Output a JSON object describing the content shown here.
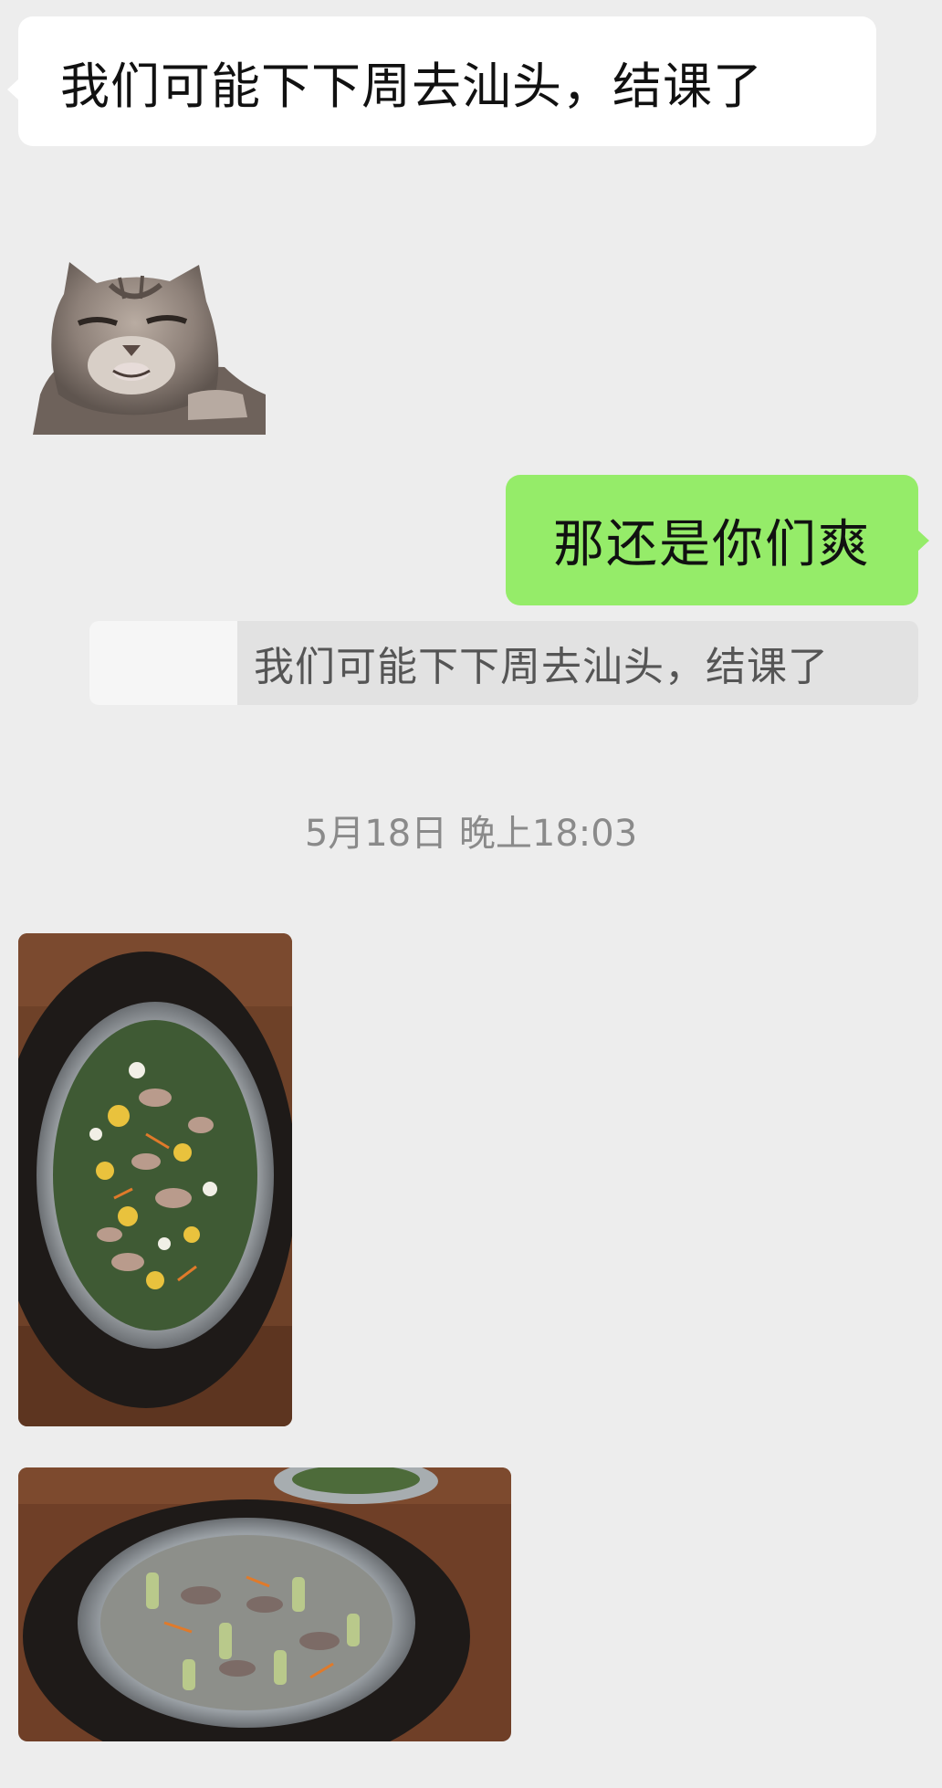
{
  "chat": {
    "incoming_message": "我们可能下下周去汕头，结课了",
    "sticker_icon": "cat-meme-sticker",
    "outgoing_message": "那还是你们爽",
    "quote_text": "我们可能下下周去汕头，结课了",
    "timestamp": "5月18日 晚上18:03",
    "photos": [
      "food-photo-steamer-vertical",
      "food-photo-steamer-horizontal"
    ]
  },
  "colors": {
    "background": "#ededed",
    "incoming_bubble": "#ffffff",
    "outgoing_bubble": "#95ec69",
    "quote_background": "#e2e2e2",
    "timestamp": "#8a8a8a"
  }
}
